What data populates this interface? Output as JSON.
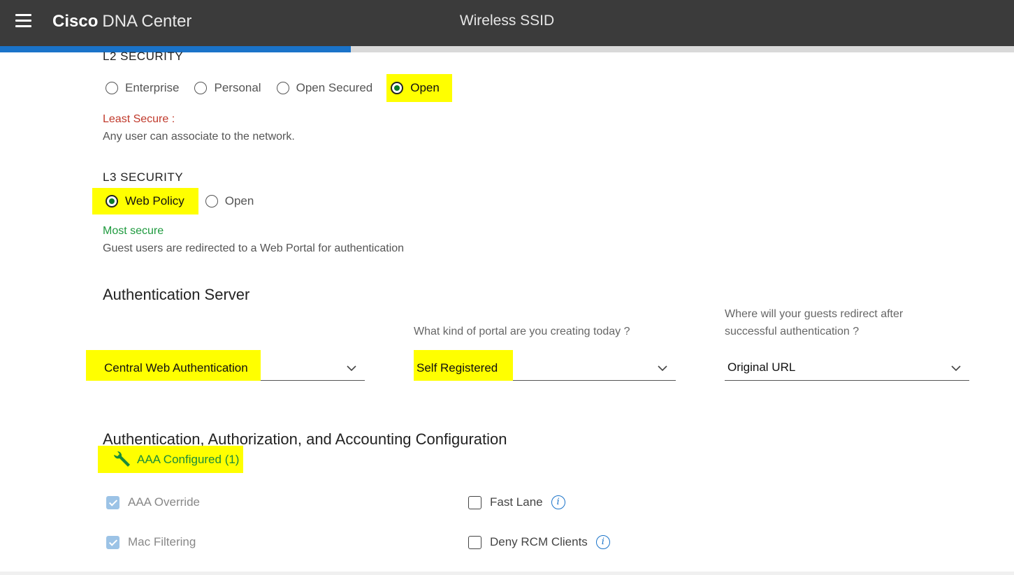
{
  "header": {
    "brand_bold": "Cisco",
    "brand_light": "DNA Center",
    "page_title": "Wireless SSID",
    "progress_fraction": 0.346
  },
  "l2": {
    "label": "L2 SECURITY",
    "options": [
      "Enterprise",
      "Personal",
      "Open Secured",
      "Open"
    ],
    "selected": "Open",
    "note_title": "Least Secure :",
    "note_desc": "Any user can associate to the network."
  },
  "l3": {
    "label": "L3 SECURITY",
    "options": [
      "Web Policy",
      "Open"
    ],
    "selected": "Web Policy",
    "note_title": "Most secure",
    "note_desc": "Guest users are redirected to a Web Portal for authentication"
  },
  "auth_server": {
    "heading": "Authentication Server",
    "server_value": "Central Web Authentication",
    "portal_hint": "What kind of portal are you creating today ?",
    "portal_value": "Self Registered",
    "redirect_hint_1": "Where will your guests redirect after",
    "redirect_hint_2": "successful authentication ?",
    "redirect_value": "Original URL"
  },
  "aaa": {
    "heading": "Authentication, Authorization, and Accounting Configuration",
    "link_label": "AAA Configured (1)",
    "icon": "wrench-icon",
    "options": [
      {
        "label": "AAA Override",
        "checked": true
      },
      {
        "label": "Mac Filtering",
        "checked": true
      },
      {
        "label": "Fast Lane",
        "checked": false
      },
      {
        "label": "Deny RCM Clients",
        "checked": false
      }
    ]
  },
  "colors": {
    "highlight": "#ffff00",
    "topbar": "#3b3b3b",
    "accent_blue": "#1a73c9",
    "least_secure_red": "#c0392b",
    "most_secure_green": "#1e9a3e"
  }
}
